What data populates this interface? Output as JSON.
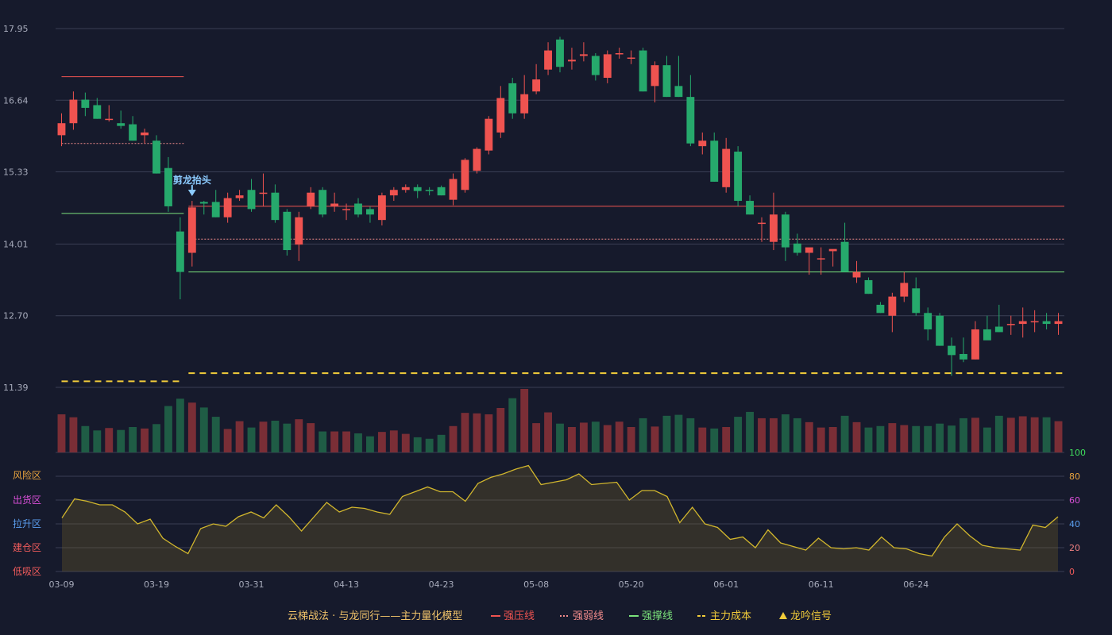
{
  "chart_data": {
    "type": "candlestick",
    "title": "云梯战法 · 与龙同行——主力量化模型",
    "dates": [
      "03-09",
      "03-10",
      "03-11",
      "03-12",
      "03-13",
      "03-16",
      "03-17",
      "03-18",
      "03-19",
      "03-20",
      "03-23",
      "03-24",
      "03-25",
      "03-26",
      "03-27",
      "03-30",
      "03-31",
      "04-01",
      "04-02",
      "04-03",
      "04-07",
      "04-08",
      "04-09",
      "04-10",
      "04-13",
      "04-14",
      "04-15",
      "04-16",
      "04-17",
      "04-20",
      "04-21",
      "04-22",
      "04-23",
      "04-24",
      "04-27",
      "04-28",
      "04-29",
      "04-30",
      "05-06",
      "05-07",
      "05-08",
      "05-11",
      "05-12",
      "05-13",
      "05-14",
      "05-15",
      "05-18",
      "05-19",
      "05-20",
      "05-21",
      "05-22",
      "05-25",
      "05-26",
      "05-27",
      "05-28",
      "05-29",
      "06-01",
      "06-02",
      "06-03",
      "06-04",
      "06-05",
      "06-08",
      "06-09",
      "06-10",
      "06-11",
      "06-12",
      "06-15",
      "06-16",
      "06-17",
      "06-18",
      "06-19",
      "06-22",
      "06-23",
      "06-24",
      "06-25",
      "06-26",
      "06-29",
      "06-30",
      "07-01",
      "07-02",
      "07-03",
      "07-06",
      "07-07",
      "07-08",
      "07-09"
    ],
    "x_tick_labels": [
      "03-09",
      "03-19",
      "03-31",
      "04-13",
      "04-23",
      "05-08",
      "05-20",
      "06-01",
      "06-11",
      "06-24"
    ],
    "x_tick_indices": [
      0,
      8,
      16,
      24,
      32,
      40,
      48,
      56,
      64,
      72
    ],
    "y_ticks": [
      "17.95",
      "16.64",
      "15.33",
      "14.01",
      "12.70",
      "11.39"
    ],
    "ylim": [
      11.39,
      17.95
    ],
    "ohlc": [
      [
        16.0,
        16.4,
        15.8,
        16.22
      ],
      [
        16.22,
        16.8,
        16.1,
        16.65
      ],
      [
        16.65,
        16.78,
        16.35,
        16.5
      ],
      [
        16.55,
        16.68,
        16.3,
        16.3
      ],
      [
        16.3,
        16.55,
        16.25,
        16.3
      ],
      [
        16.22,
        16.45,
        16.12,
        16.17
      ],
      [
        16.2,
        16.35,
        15.9,
        15.9
      ],
      [
        16.0,
        16.12,
        15.85,
        16.05
      ],
      [
        15.9,
        16.0,
        15.3,
        15.3
      ],
      [
        15.4,
        15.6,
        14.6,
        14.7
      ],
      [
        14.24,
        14.5,
        13.0,
        13.5
      ],
      [
        13.85,
        14.8,
        13.6,
        14.68
      ],
      [
        14.78,
        14.8,
        14.55,
        14.75
      ],
      [
        14.78,
        15.0,
        14.5,
        14.5
      ],
      [
        14.5,
        14.95,
        14.4,
        14.85
      ],
      [
        14.85,
        15.0,
        14.8,
        14.9
      ],
      [
        15.0,
        15.2,
        14.6,
        14.65
      ],
      [
        14.95,
        15.3,
        14.7,
        14.95
      ],
      [
        14.95,
        15.1,
        14.4,
        14.45
      ],
      [
        14.6,
        14.65,
        13.8,
        13.9
      ],
      [
        14.0,
        14.6,
        13.7,
        14.5
      ],
      [
        14.7,
        15.05,
        14.65,
        14.95
      ],
      [
        15.0,
        15.05,
        14.5,
        14.55
      ],
      [
        14.7,
        14.95,
        14.6,
        14.75
      ],
      [
        14.65,
        14.75,
        14.45,
        14.65
      ],
      [
        14.75,
        14.85,
        14.5,
        14.55
      ],
      [
        14.65,
        14.7,
        14.4,
        14.55
      ],
      [
        14.45,
        14.95,
        14.35,
        14.9
      ],
      [
        14.9,
        15.05,
        14.8,
        15.0
      ],
      [
        15.0,
        15.1,
        14.95,
        15.05
      ],
      [
        15.05,
        15.1,
        14.85,
        14.98
      ],
      [
        15.0,
        15.05,
        14.9,
        14.98
      ],
      [
        15.05,
        15.08,
        14.9,
        14.9
      ],
      [
        14.82,
        15.3,
        14.72,
        15.2
      ],
      [
        15.0,
        15.58,
        14.95,
        15.55
      ],
      [
        15.35,
        15.78,
        15.3,
        15.75
      ],
      [
        15.72,
        16.35,
        15.65,
        16.3
      ],
      [
        16.05,
        16.9,
        15.95,
        16.68
      ],
      [
        16.95,
        17.05,
        16.3,
        16.4
      ],
      [
        16.4,
        17.1,
        16.3,
        16.75
      ],
      [
        16.8,
        17.3,
        16.75,
        17.02
      ],
      [
        17.2,
        17.7,
        17.1,
        17.55
      ],
      [
        17.75,
        17.8,
        17.15,
        17.25
      ],
      [
        17.35,
        17.6,
        17.2,
        17.38
      ],
      [
        17.45,
        17.7,
        17.35,
        17.48
      ],
      [
        17.45,
        17.5,
        17.0,
        17.1
      ],
      [
        17.05,
        17.55,
        16.95,
        17.48
      ],
      [
        17.48,
        17.6,
        17.4,
        17.5
      ],
      [
        17.4,
        17.55,
        17.3,
        17.42
      ],
      [
        17.55,
        17.6,
        16.8,
        16.8
      ],
      [
        16.9,
        17.35,
        16.6,
        17.28
      ],
      [
        17.28,
        17.45,
        16.7,
        16.7
      ],
      [
        16.9,
        17.45,
        16.7,
        16.7
      ],
      [
        16.7,
        17.1,
        15.8,
        15.85
      ],
      [
        15.8,
        16.05,
        15.65,
        15.9
      ],
      [
        15.9,
        16.05,
        15.15,
        15.15
      ],
      [
        15.05,
        15.95,
        14.95,
        15.75
      ],
      [
        15.7,
        15.8,
        14.7,
        14.8
      ],
      [
        14.8,
        14.9,
        14.55,
        14.55
      ],
      [
        14.4,
        14.5,
        14.05,
        14.4
      ],
      [
        14.05,
        14.95,
        13.9,
        14.55
      ],
      [
        14.55,
        14.6,
        13.7,
        13.95
      ],
      [
        14.02,
        14.2,
        13.8,
        13.85
      ],
      [
        13.85,
        13.9,
        13.45,
        13.95
      ],
      [
        13.75,
        13.95,
        13.45,
        13.75
      ],
      [
        13.88,
        13.9,
        13.6,
        13.92
      ],
      [
        14.05,
        14.4,
        13.55,
        13.5
      ],
      [
        13.4,
        13.7,
        13.3,
        13.5
      ],
      [
        13.35,
        13.4,
        13.1,
        13.1
      ],
      [
        12.9,
        12.95,
        12.75,
        12.75
      ],
      [
        12.7,
        13.12,
        12.4,
        13.05
      ],
      [
        13.05,
        13.5,
        12.95,
        13.3
      ],
      [
        13.2,
        13.4,
        12.7,
        12.75
      ],
      [
        12.75,
        12.85,
        12.25,
        12.45
      ],
      [
        12.7,
        12.75,
        12.15,
        12.15
      ],
      [
        12.15,
        12.3,
        11.6,
        11.98
      ],
      [
        12.0,
        12.3,
        11.85,
        11.9
      ],
      [
        11.9,
        12.6,
        11.9,
        12.45
      ],
      [
        12.45,
        12.7,
        12.35,
        12.25
      ],
      [
        12.5,
        12.9,
        12.4,
        12.4
      ],
      [
        12.55,
        12.7,
        12.35,
        12.55
      ],
      [
        12.55,
        12.85,
        12.3,
        12.6
      ],
      [
        12.6,
        12.8,
        12.4,
        12.6
      ],
      [
        12.6,
        12.75,
        12.45,
        12.55
      ],
      [
        12.55,
        12.75,
        12.35,
        12.6
      ]
    ],
    "volume": [
      78,
      72,
      54,
      45,
      50,
      46,
      52,
      49,
      58,
      95,
      110,
      102,
      92,
      73,
      48,
      64,
      51,
      63,
      65,
      59,
      68,
      60,
      43,
      43,
      43,
      39,
      33,
      42,
      45,
      38,
      31,
      28,
      36,
      54,
      81,
      80,
      78,
      91,
      111,
      130,
      60,
      82,
      59,
      52,
      61,
      63,
      56,
      63,
      52,
      70,
      53,
      75,
      77,
      70,
      51,
      49,
      52,
      73,
      83,
      70,
      70,
      78,
      70,
      62,
      51,
      52,
      75,
      62,
      51,
      54,
      60,
      56,
      54,
      54,
      59,
      55,
      70,
      71,
      51,
      75,
      71,
      74,
      72,
      72,
      64
    ],
    "oscillator": [
      45,
      61,
      59,
      56,
      56,
      50,
      40,
      44,
      28,
      21,
      15,
      36,
      40,
      38,
      46,
      50,
      45,
      56,
      46,
      34,
      46,
      58,
      50,
      54,
      53,
      50,
      48,
      63,
      67,
      71,
      67,
      67,
      59,
      74,
      79,
      82,
      86,
      89,
      73,
      75,
      77,
      82,
      73,
      74,
      75,
      60,
      68,
      68,
      63,
      41,
      54,
      40,
      37,
      27,
      29,
      20,
      35,
      24,
      21,
      18,
      28,
      20,
      19,
      20,
      18,
      29,
      20,
      19,
      15,
      13,
      29,
      40,
      30,
      22,
      20,
      19,
      18,
      39,
      37,
      46
    ],
    "oscillator_ticks": [
      "100",
      "80",
      "60",
      "40",
      "20",
      "0"
    ],
    "zones": [
      {
        "label": "风险区",
        "color": "#e8a33d"
      },
      {
        "label": "出货区",
        "color": "#d94fd8"
      },
      {
        "label": "拉升区",
        "color": "#5b9ff0"
      },
      {
        "label": "建仓区",
        "color": "#ef5b5b"
      },
      {
        "label": "低吸区",
        "color": "#ef5b5b"
      }
    ],
    "annotation": {
      "text": "剪龙抬头",
      "index": 11
    },
    "levels": {
      "strong_resistance_1": 17.07,
      "strong_resistance_2": 14.7,
      "weak_line_1": 15.85,
      "weak_line_2": 14.1,
      "strong_support_1": 14.57,
      "strong_support_2": 13.5,
      "main_cost_1": 11.5,
      "main_cost_2": 11.65
    },
    "legend": [
      {
        "label": "强压线",
        "color": "#ef5350",
        "style": "solid"
      },
      {
        "label": "强弱线",
        "color": "#f28c8c",
        "style": "dotted"
      },
      {
        "label": "强撑线",
        "color": "#7be27b",
        "style": "solid"
      },
      {
        "label": "主力成本",
        "color": "#f2cc3a",
        "style": "dashed"
      },
      {
        "label": "龙吟信号",
        "color": "#f2cc3a",
        "style": "triangle"
      }
    ],
    "colors": {
      "up": "#ef5350",
      "down": "#26a96c",
      "up_volume": "#7a2e36",
      "down_volume": "#1f5c45",
      "grid": "#3a3f55",
      "axis_text": "#a7abbb",
      "oscillator_line": "#d1b62d",
      "annotation": "#8ccbff",
      "title": "#f0c36a"
    }
  }
}
